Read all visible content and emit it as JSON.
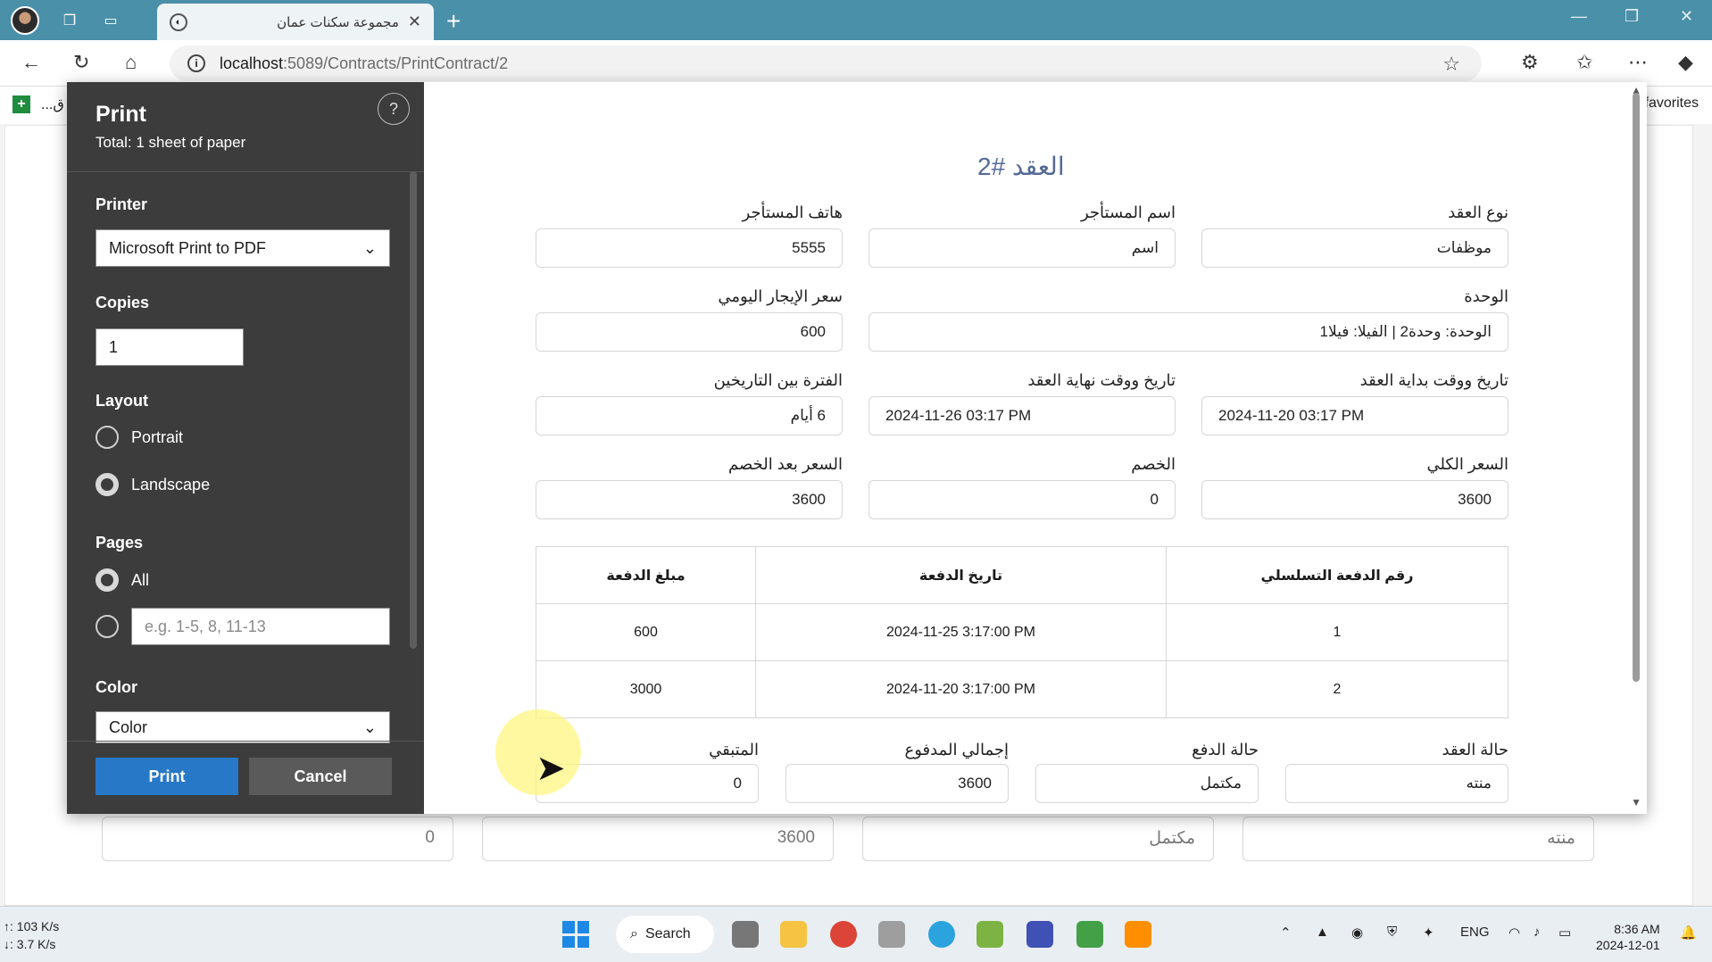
{
  "browser": {
    "tab_title": "مجموعة سكنات عمان",
    "url_host": "localhost",
    "url_path": ":5089/Contracts/PrintContract/2",
    "bookmark_label": "...ق",
    "favorites_label": "favorites"
  },
  "print_dialog": {
    "title": "Print",
    "subtitle": "Total: 1 sheet of paper",
    "help": "?",
    "printer_label": "Printer",
    "printer_value": "Microsoft Print to PDF",
    "copies_label": "Copies",
    "copies_value": "1",
    "layout_label": "Layout",
    "layout_options": [
      "Portrait",
      "Landscape"
    ],
    "layout_selected": "Landscape",
    "pages_label": "Pages",
    "pages_all": "All",
    "pages_placeholder": "e.g. 1-5, 8, 11-13",
    "color_label": "Color",
    "color_value": "Color",
    "print_button": "Print",
    "cancel_button": "Cancel"
  },
  "contract": {
    "title": "العقد #2",
    "fields": {
      "contract_type": {
        "label": "نوع العقد",
        "value": "موظفات"
      },
      "tenant_name": {
        "label": "اسم المستأجر",
        "value": "اسم"
      },
      "tenant_phone": {
        "label": "هاتف المستأجر",
        "value": "5555"
      },
      "unit": {
        "label": "الوحدة",
        "value": "الوحدة: وحدة2 | الفيلا: فيلا1"
      },
      "daily_rent": {
        "label": "سعر الإيجار اليومي",
        "value": "600"
      },
      "start_date": {
        "label": "تاريخ ووقت بداية العقد",
        "value": "2024-11-20 03:17 PM"
      },
      "end_date": {
        "label": "تاريخ ووقت نهاية العقد",
        "value": "2024-11-26 03:17 PM"
      },
      "period": {
        "label": "الفترة بين التاريخين",
        "value": "6 أيام"
      },
      "total_price": {
        "label": "السعر الكلي",
        "value": "3600"
      },
      "discount": {
        "label": "الخصم",
        "value": "0"
      },
      "price_after_discount": {
        "label": "السعر بعد الخصم",
        "value": "3600"
      },
      "contract_status": {
        "label": "حالة العقد",
        "value": "منته"
      },
      "payment_status": {
        "label": "حالة الدفع",
        "value": "مكتمل"
      },
      "total_paid": {
        "label": "إجمالي المدفوع",
        "value": "3600"
      },
      "remaining": {
        "label": "المتبقي",
        "value": "0"
      }
    },
    "payments_table": {
      "headers": [
        "رقم الدفعة التسلسلي",
        "تاريخ الدفعة",
        "مبلغ الدفعة"
      ],
      "rows": [
        [
          "1",
          "2024-11-25 3:17:00 PM",
          "600"
        ],
        [
          "2",
          "2024-11-20 3:17:00 PM",
          "3000"
        ]
      ]
    }
  },
  "background_fields": [
    "منته",
    "مكتمل",
    "3600",
    "0"
  ],
  "taskbar": {
    "net_up": "↑: 103 K/s",
    "net_down": "↓: 3.7 K/s",
    "search_label": "Search",
    "lang": "ENG",
    "time": "8:36 AM",
    "date": "2024-12-01"
  }
}
